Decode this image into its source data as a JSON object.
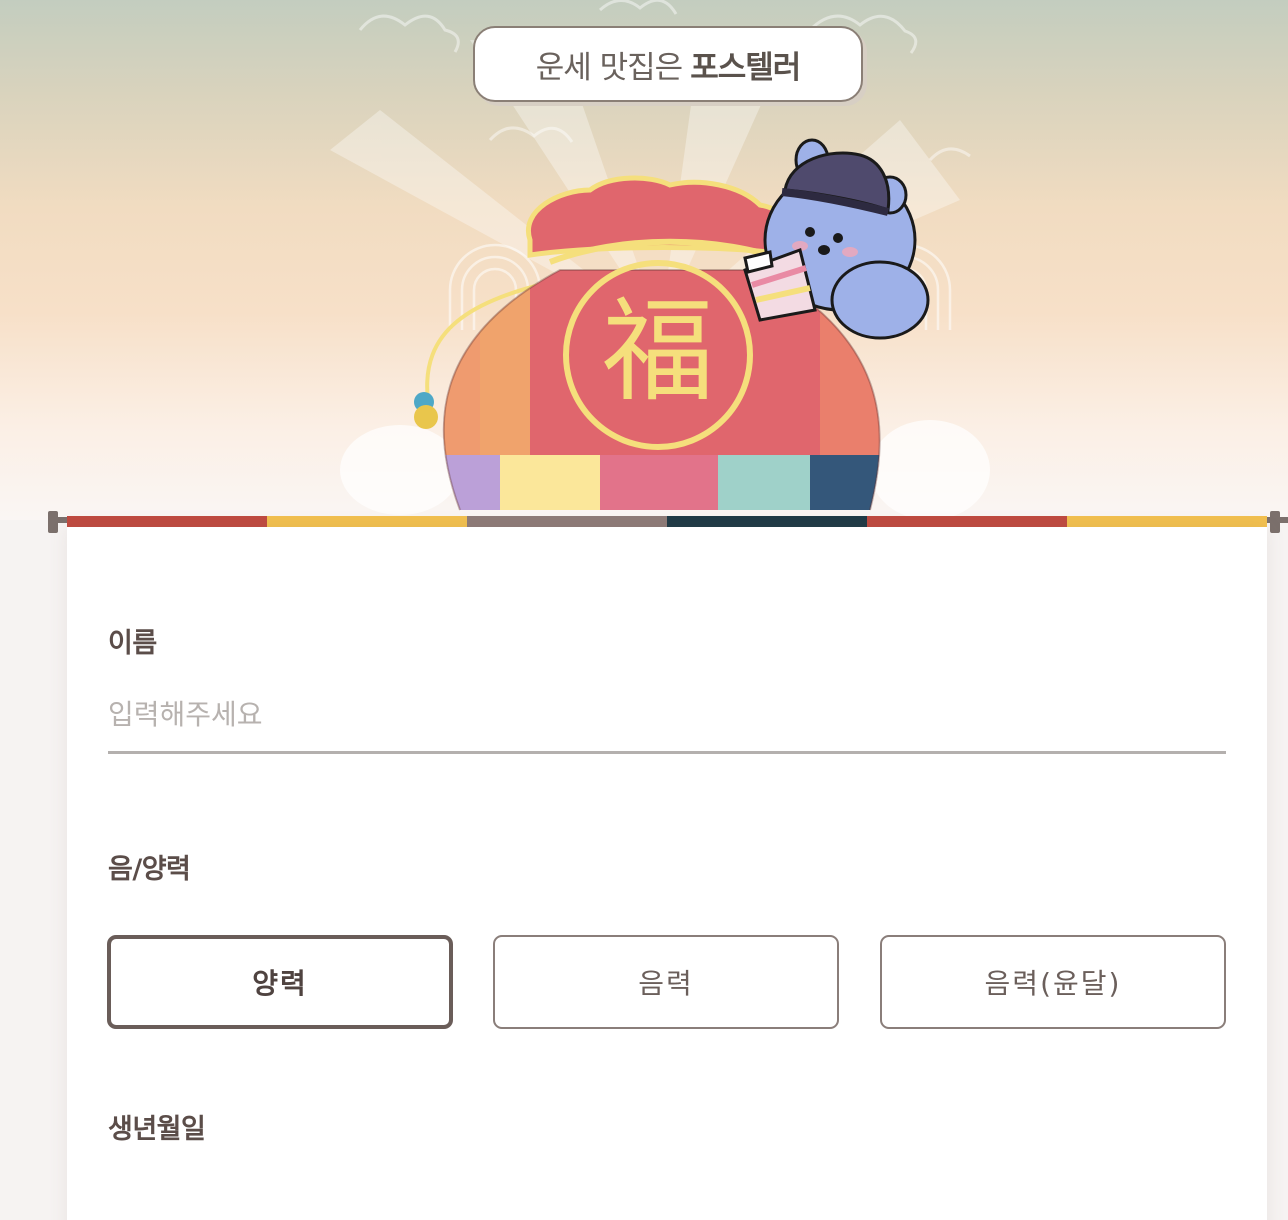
{
  "hero": {
    "bubble_text": "운세 맛집은",
    "bubble_brand": "포스텔러",
    "bag_character": "福"
  },
  "colors": {
    "stripe": [
      "#bf4a40",
      "#f2c04f",
      "#8e7b78",
      "#1f3a46",
      "#bf4a40",
      "#f2c04f"
    ],
    "text_primary": "#5b4d49",
    "placeholder": "#b7b2af"
  },
  "form": {
    "name": {
      "label": "이름",
      "placeholder": "입력해주세요",
      "value": ""
    },
    "calendar": {
      "label": "음/양력",
      "options": [
        "양력",
        "음력",
        "음력(윤달)"
      ],
      "selected": "양력"
    },
    "birthdate": {
      "label": "생년월일"
    }
  }
}
